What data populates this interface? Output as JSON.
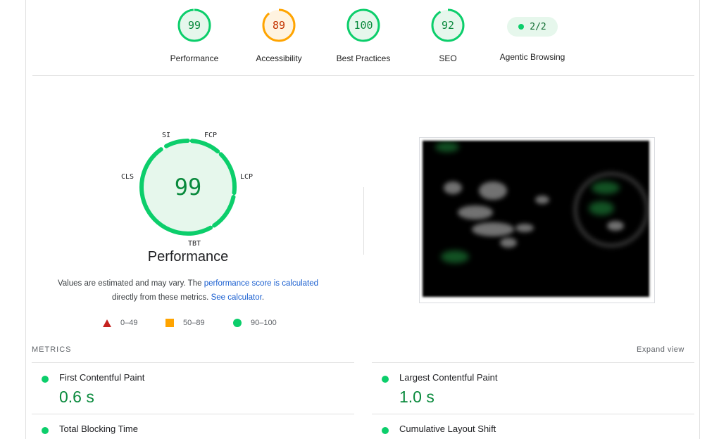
{
  "categories": [
    {
      "score": "99",
      "label": "Performance",
      "fraction": 0.99,
      "color": "#0cce6b"
    },
    {
      "score": "89",
      "label": "Accessibility",
      "fraction": 0.89,
      "color": "#ffa400"
    },
    {
      "score": "100",
      "label": "Best Practices",
      "fraction": 1.0,
      "color": "#0cce6b"
    },
    {
      "score": "92",
      "label": "SEO",
      "fraction": 0.92,
      "color": "#0cce6b"
    }
  ],
  "agentic": {
    "value": "2/2",
    "label": "Agentic Browsing"
  },
  "performance": {
    "score": "99",
    "title": "Performance",
    "metric_labels": {
      "si": "SI",
      "fcp": "FCP",
      "lcp": "LCP",
      "tbt": "TBT",
      "cls": "CLS"
    },
    "desc_text": "Values are estimated and may vary. The ",
    "desc_link1": "performance score is calculated",
    "desc_text2": "directly from these metrics. ",
    "desc_link2": "See calculator",
    "desc_end": "."
  },
  "legend": [
    {
      "range": "0–49",
      "icon": "triangle-icon",
      "color": "#c5221f"
    },
    {
      "range": "50–89",
      "icon": "square-icon",
      "color": "#ffa400"
    },
    {
      "range": "90–100",
      "icon": "circle-icon",
      "color": "#0cce6b"
    }
  ],
  "metrics": {
    "title": "METRICS",
    "expand_label": "Expand view",
    "items": [
      {
        "name": "First Contentful Paint",
        "value": "0.6 s"
      },
      {
        "name": "Largest Contentful Paint",
        "value": "1.0 s"
      },
      {
        "name": "Total Blocking Time",
        "value": ""
      },
      {
        "name": "Cumulative Layout Shift",
        "value": ""
      }
    ]
  },
  "colors": {
    "pass": "#0cce6b",
    "average": "#ffa400",
    "fail": "#c5221f",
    "link": "#1a5fd0"
  }
}
